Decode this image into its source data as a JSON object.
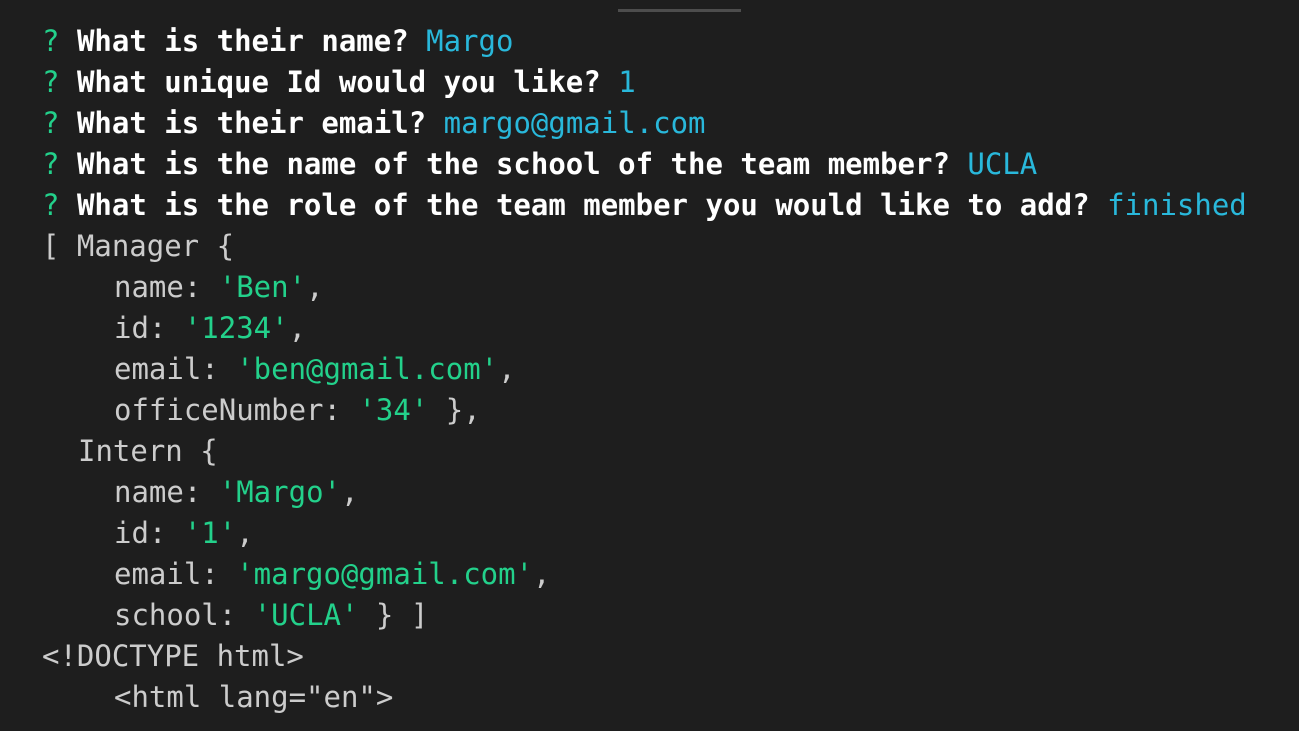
{
  "colors": {
    "background": "#1e1e1e",
    "prompt_marker": "#23d18b",
    "question_text": "#ffffff",
    "answer_text": "#29b8db",
    "string_value": "#23d18b",
    "plain_text": "#cccccc"
  },
  "prompts": [
    {
      "marker": "?",
      "question": "What is their name?",
      "answer": "Margo"
    },
    {
      "marker": "?",
      "question": "What unique Id would you like?",
      "answer": "1"
    },
    {
      "marker": "?",
      "question": "What is their email?",
      "answer": "margo@gmail.com"
    },
    {
      "marker": "?",
      "question": "What is the name of the school of the team member?",
      "answer": "UCLA"
    },
    {
      "marker": "?",
      "question": "What is the role of the team member you would like to add?",
      "answer": "finished"
    }
  ],
  "output": {
    "manager": {
      "open": "[ Manager {",
      "name_key": "name: ",
      "name_value": "'Ben'",
      "name_end": ",",
      "id_key": "id: ",
      "id_value": "'1234'",
      "id_end": ",",
      "email_key": "email: ",
      "email_value": "'ben@gmail.com'",
      "email_end": ",",
      "office_key": "officeNumber: ",
      "office_value": "'34'",
      "office_end": " },"
    },
    "intern": {
      "open": "Intern {",
      "name_key": "name: ",
      "name_value": "'Margo'",
      "name_end": ",",
      "id_key": "id: ",
      "id_value": "'1'",
      "id_end": ",",
      "email_key": "email: ",
      "email_value": "'margo@gmail.com'",
      "email_end": ",",
      "school_key": "school: ",
      "school_value": "'UCLA'",
      "school_end": " } ]"
    },
    "doctype": "<!DOCTYPE html>",
    "html_tag": "<html lang=\"en\">"
  }
}
